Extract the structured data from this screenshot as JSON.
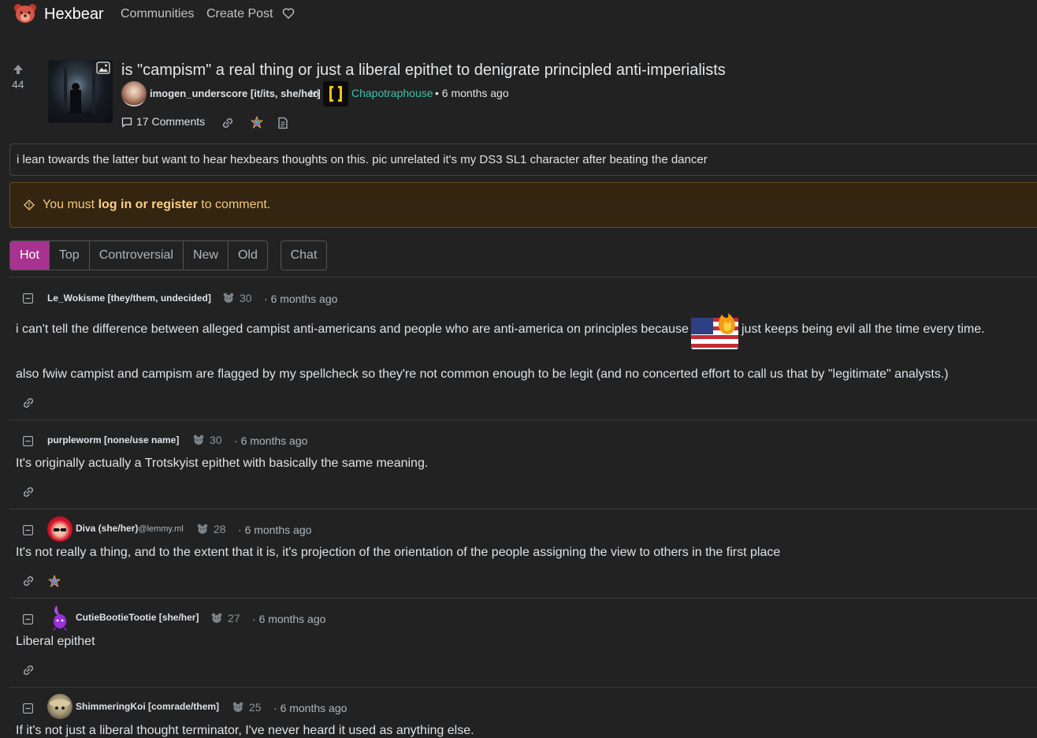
{
  "navbar": {
    "brand": "Hexbear",
    "links": [
      "Communities",
      "Create Post"
    ],
    "icons": [
      "bear-logo-icon",
      "heart-icon"
    ]
  },
  "post": {
    "score": "44",
    "title": "is \"campism\" a real thing or just a liberal epithet to denigrate principled anti-imperialists",
    "author": "imogen_underscore [it/its, she/her]",
    "to": "to",
    "community": "Chapotraphouse",
    "time": "• 6 months ago",
    "comments_label": "17 Comments",
    "body": "i lean towards the latter but want to hear hexbears thoughts on this. pic unrelated it's my DS3 SL1 character after beating the dancer"
  },
  "alert": {
    "prefix": "You must ",
    "link": "log in or register",
    "suffix": " to comment."
  },
  "sort": {
    "options": [
      "Hot",
      "Top",
      "Controversial",
      "New",
      "Old"
    ],
    "active": "Hot",
    "chat": "Chat"
  },
  "comments": [
    {
      "author": "Le_Wokisme [they/them, undecided]",
      "score": "30",
      "time": "6 months ago",
      "body_1a": "i can't tell the difference between alleged campist anti-americans and people who are anti-america on principles because",
      "body_1b": "just keeps being evil all the time every time.",
      "body_2": "also fwiw campist and campism are flagged by my spellcheck so they're not common enough to be legit (and no concerted effort to call us that by \"legitimate\" analysts.)"
    },
    {
      "author": "purpleworm [none/use name]",
      "score": "30",
      "time": "6 months ago",
      "body": "It's originally actually a Trotskyist epithet with basically the same meaning."
    },
    {
      "author": "Diva (she/her)",
      "instance": "@lemmy.ml",
      "score": "28",
      "time": "6 months ago",
      "body": "It's not really a thing, and to the extent that it is, it's projection of the orientation of the people assigning the view to others in the first place"
    },
    {
      "author": "CutieBootieTootie [she/her]",
      "score": "27",
      "time": "6 months ago",
      "body": "Liberal epithet"
    },
    {
      "author": "ShimmeringKoi [comrade/them]",
      "score": "25",
      "time": "6 months ago",
      "body": "If it's not just a liberal thought terminator, I've never heard it used as anything else."
    }
  ],
  "colors": {
    "background": "#222222",
    "accent": "#a7328f",
    "community_link": "#3fc0a8",
    "alert_bg": "#332510",
    "alert_text": "#f5c77e"
  }
}
